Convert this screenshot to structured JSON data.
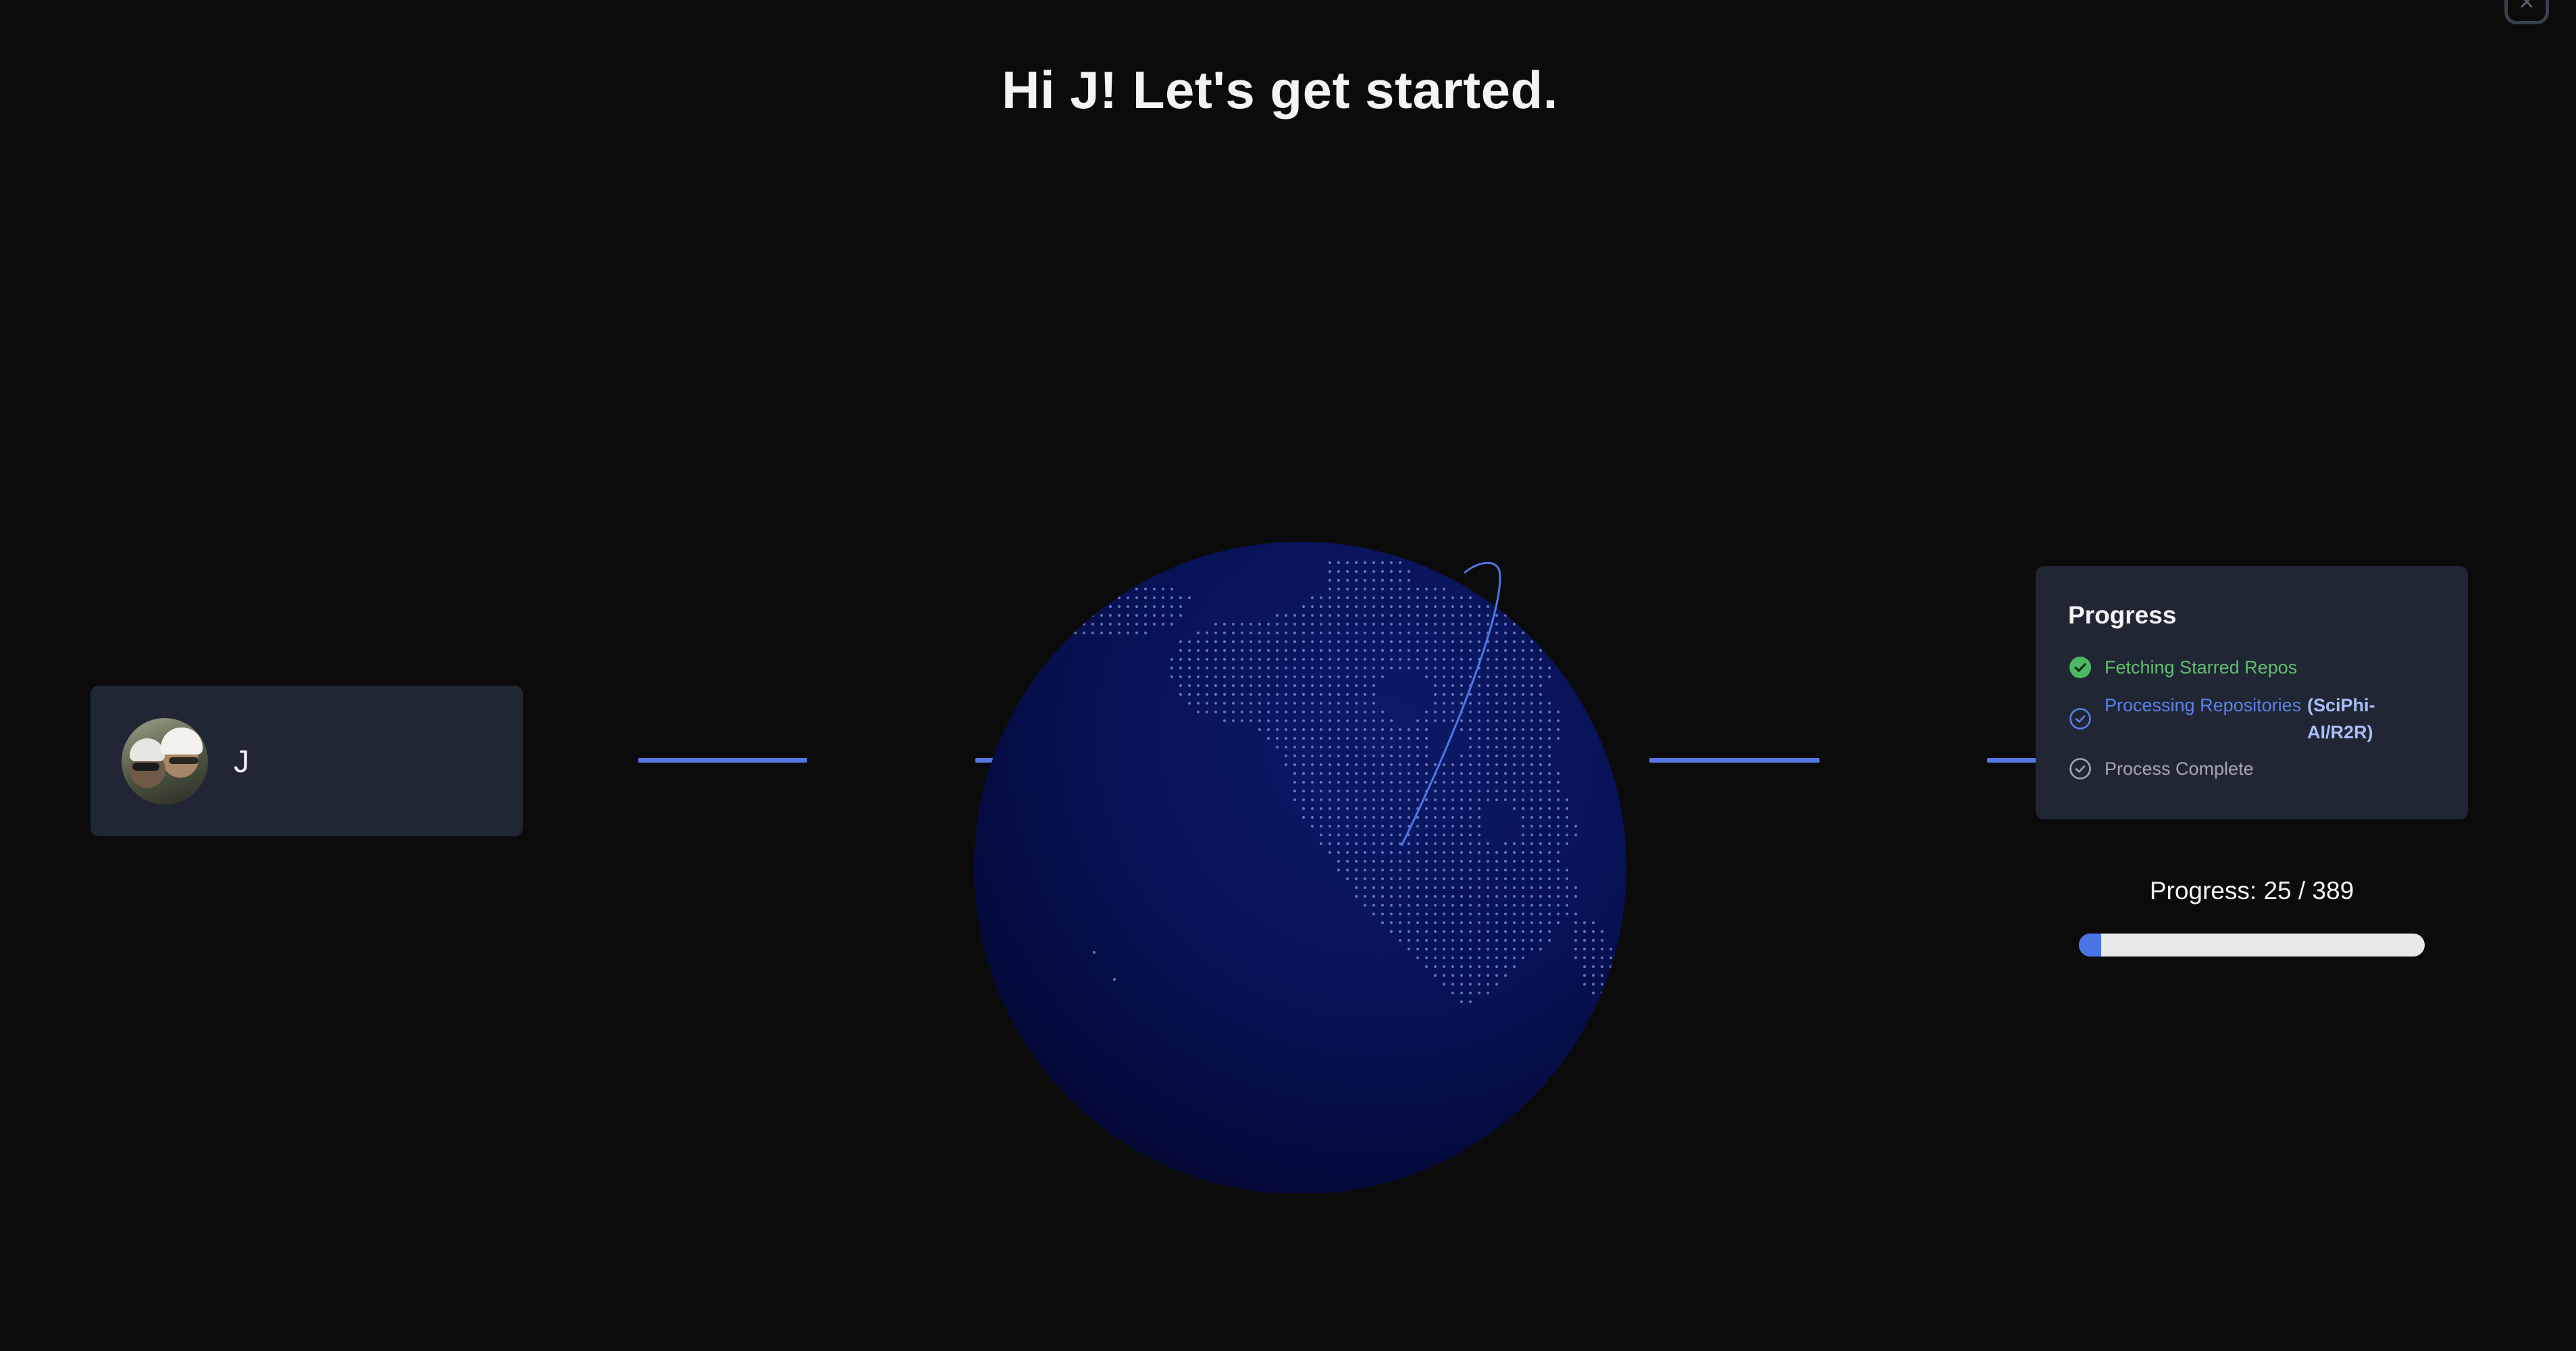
{
  "header": {
    "title": "Hi J! Let's get started."
  },
  "user": {
    "name": "J"
  },
  "progress_panel": {
    "title": "Progress",
    "steps": [
      {
        "label": "Fetching Starred Repos",
        "status": "done",
        "color": "#5fbf6f"
      },
      {
        "label": "Processing Repositories",
        "detail": "(SciPhi-AI/R2R)",
        "status": "in-progress",
        "color": "#5b82ea"
      },
      {
        "label": "Process Complete",
        "status": "pending",
        "color": "#a3a7ae"
      }
    ]
  },
  "progress": {
    "text": "Progress: 25 / 389",
    "current": 25,
    "total": 389,
    "fraction": 0.0643
  },
  "colors": {
    "background": "#0b0b0b",
    "card": "#202633",
    "accent": "#5477e3",
    "success": "#5fbf6f",
    "globe": "#07104a"
  },
  "icons": {
    "close": "close-icon",
    "done": "check-circle-filled-icon",
    "in_progress": "check-circle-outline-icon",
    "pending": "check-circle-outline-icon"
  }
}
